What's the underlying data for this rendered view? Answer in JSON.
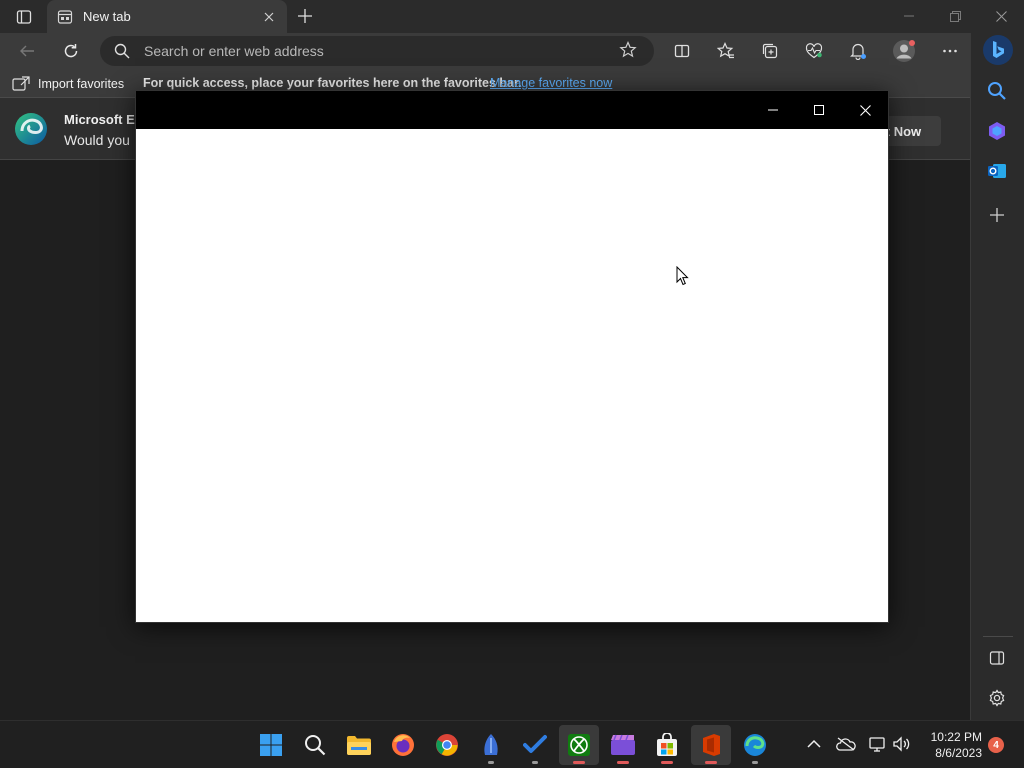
{
  "browser": {
    "tab_title": "New tab",
    "address_placeholder": "Search or enter web address"
  },
  "favorites_bar": {
    "import_label": "Import favorites",
    "message": "For quick access, place your favorites here on the favorites bar.",
    "manage_link": "Manage favorites now"
  },
  "notification": {
    "title": "Microsoft Ed",
    "body": "Would you",
    "not_now_label": "ot Now"
  },
  "taskbar": {
    "time": "10:22 PM",
    "date": "8/6/2023",
    "notification_count": "4"
  },
  "colors": {
    "accent": "#5fb2ff",
    "popup_body": "#ffffff",
    "popup_titlebar": "#000000",
    "badge": "#e8614a"
  }
}
